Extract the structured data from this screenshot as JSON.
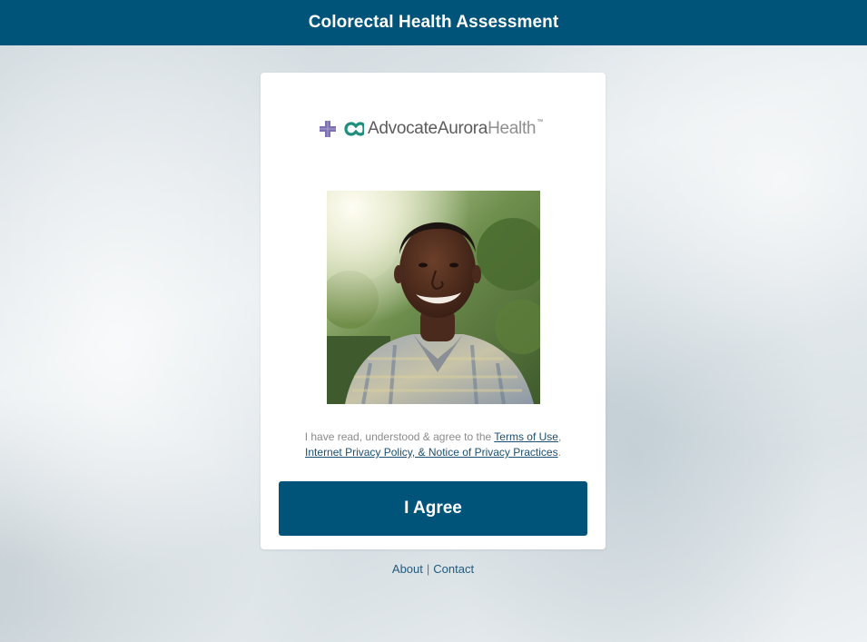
{
  "header": {
    "title": "Colorectal Health Assessment"
  },
  "logo": {
    "text_dark": "AdvocateAurora",
    "text_light": "Health",
    "trademark": "™",
    "icon": "advocate-aurora-cross-and-loop-icon"
  },
  "photo": {
    "subject": "smiling-man-portrait"
  },
  "consent": {
    "prefix": "I have read, understood & agree to the ",
    "terms_link": "Terms of Use",
    "comma": ",",
    "privacy_link": "Internet Privacy Policy, & Notice of Privacy Practices",
    "suffix": "."
  },
  "agree_button": {
    "label": "I Agree"
  },
  "footer": {
    "about": "About",
    "separator": "|",
    "contact": "Contact"
  },
  "colors": {
    "brand": "#005479",
    "link": "#1b4f72",
    "logo_purple": "#7d6fb3",
    "logo_teal": "#1f8f7d"
  }
}
